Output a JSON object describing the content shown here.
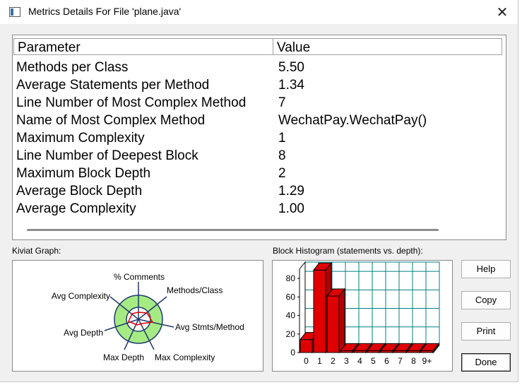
{
  "window": {
    "title": "Metrics Details For File 'plane.java'",
    "close_glyph": "✕"
  },
  "table": {
    "headers": [
      "Parameter",
      "Value"
    ],
    "rows": [
      [
        "Methods per Class",
        "5.50"
      ],
      [
        "Average Statements per Method",
        "1.34"
      ],
      [
        "Line Number of Most Complex Method",
        "7"
      ],
      [
        "Name of Most Complex Method",
        "WechatPay.WechatPay()"
      ],
      [
        "Maximum Complexity",
        "1"
      ],
      [
        "Line Number of Deepest Block",
        "8"
      ],
      [
        "Maximum Block Depth",
        "2"
      ],
      [
        "Average Block Depth",
        "1.29"
      ],
      [
        "Average Complexity",
        "1.00"
      ]
    ]
  },
  "kiviat": {
    "label": "Kiviat Graph:",
    "axes": [
      "% Comments",
      "Methods/Class",
      "Avg Stmts/Method",
      "Max Complexity",
      "Max Depth",
      "Avg Depth",
      "Avg Complexity"
    ]
  },
  "histogram": {
    "label": "Block Histogram (statements vs. depth):",
    "categories": [
      "0",
      "1",
      "2",
      "3",
      "4",
      "5",
      "6",
      "7",
      "8",
      "9+"
    ],
    "values": [
      14,
      89,
      61,
      2,
      2,
      2,
      2,
      2,
      2,
      2
    ],
    "y_ticks": [
      "0",
      "20",
      "40",
      "60",
      "80"
    ],
    "ylim": [
      0,
      90
    ],
    "bar_color": "#e00000",
    "grid_color": "#008080"
  },
  "buttons": {
    "help": "Help",
    "copy": "Copy",
    "print": "Print",
    "done": "Done"
  }
}
